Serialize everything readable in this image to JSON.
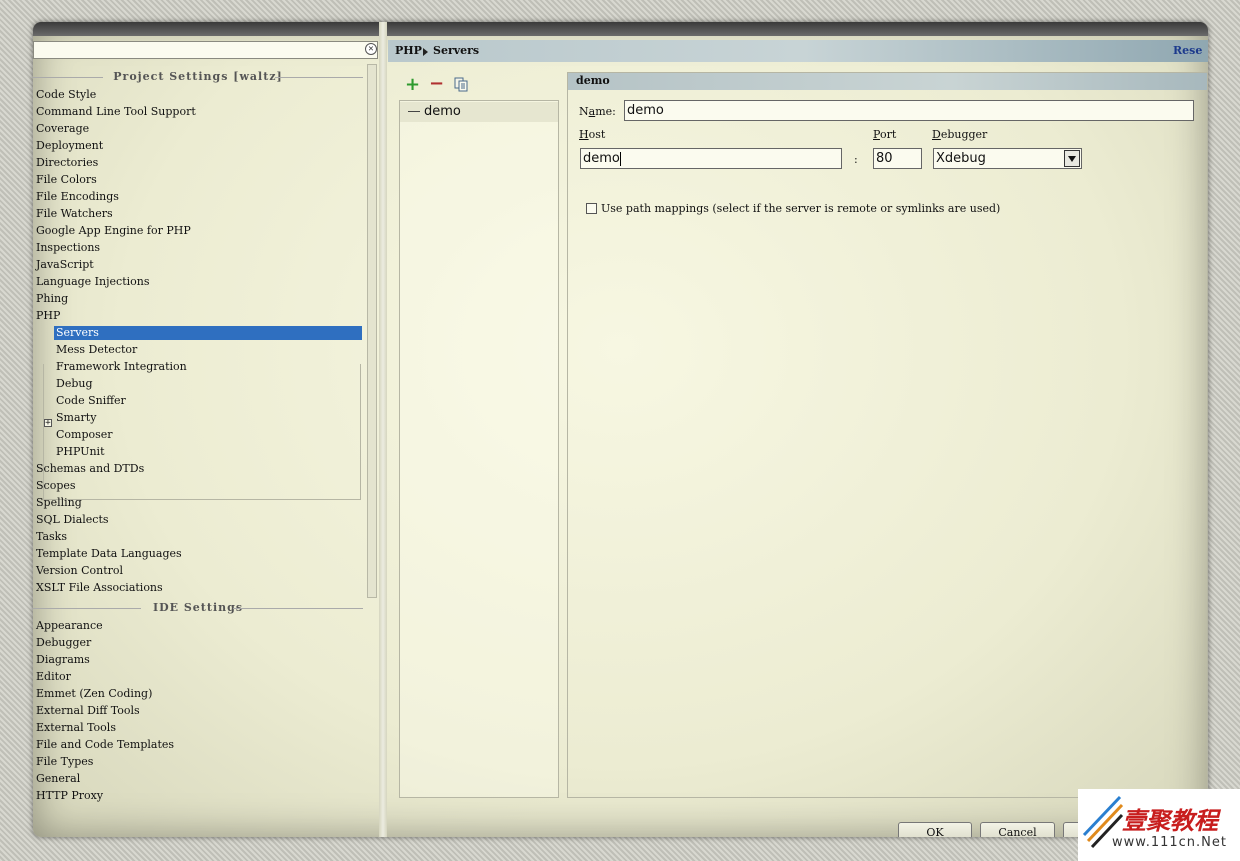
{
  "search": {
    "value": ""
  },
  "tree": {
    "project_header": "Project Settings [waltz]",
    "project_items": [
      "Code Style",
      "Command Line Tool Support",
      "Coverage",
      "Deployment",
      "Directories",
      "File Colors",
      "File Encodings",
      "File Watchers",
      "Google App Engine for PHP",
      "Inspections",
      "JavaScript",
      "Language Injections",
      "Phing",
      "PHP"
    ],
    "php_children": [
      "Servers",
      "Mess Detector",
      "Framework Integration",
      "Debug",
      "Code Sniffer",
      "Smarty",
      "Composer",
      "PHPUnit"
    ],
    "project_items_after": [
      "Schemas and DTDs",
      "Scopes",
      "Spelling",
      "SQL Dialects",
      "Tasks",
      "Template Data Languages",
      "Version Control",
      "XSLT File Associations"
    ],
    "ide_header": "IDE Settings",
    "ide_items": [
      "Appearance",
      "Debugger",
      "Diagrams",
      "Editor",
      "Emmet (Zen Coding)",
      "External Diff Tools",
      "External Tools",
      "File and Code Templates",
      "File Types",
      "General",
      "HTTP Proxy"
    ]
  },
  "breadcrumb": {
    "parent": "PHP",
    "current": "Servers",
    "reset": "Rese"
  },
  "servers": {
    "items": [
      "demo"
    ]
  },
  "detail": {
    "title": "demo",
    "name_label_pre": "N",
    "name_label_u": "a",
    "name_label_post": "me:",
    "name_value": "demo",
    "host_label_u": "H",
    "host_label_post": "ost",
    "host_value": "demo",
    "port_label_u": "P",
    "port_label_post": "ort",
    "port_sep": ":",
    "port_value": "80",
    "debugger_label_u": "D",
    "debugger_label_post": "ebugger",
    "debugger_value": "Xdebug",
    "path_mappings_label": "Use path mappings (select if the server is remote or symlinks are used)"
  },
  "buttons": {
    "ok": "OK",
    "cancel": "Cancel"
  },
  "watermark": {
    "cn": "壹聚教程",
    "url": "www.111cn.Net"
  }
}
